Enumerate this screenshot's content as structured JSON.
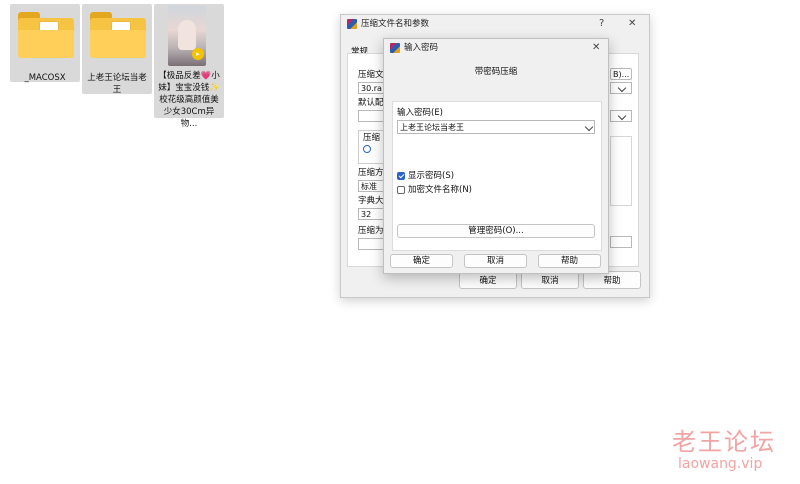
{
  "desktop": {
    "items": [
      {
        "label": "_MACOSX",
        "icon": "folder-icon"
      },
      {
        "label": "上老王论坛当老王",
        "icon": "folder-icon"
      },
      {
        "label": "【极品反差💗小妹】宝宝没钱✨校花级高颜值美少女30Cm异物...",
        "icon": "image-thumbnail"
      }
    ]
  },
  "archive_dialog": {
    "title": "压缩文件名和参数",
    "help_glyph": "?",
    "close_glyph": "✕",
    "tab_general": "常规",
    "labels": {
      "archive_name": "压缩文",
      "default_profile": "默认配",
      "archive_format": "压缩",
      "method": "压缩方",
      "dictionary": "字典大",
      "split": "压缩为"
    },
    "values": {
      "archive_name": "30.ra",
      "browse": "B)...",
      "method": "标准",
      "dictionary": "32"
    },
    "buttons": {
      "ok": "确定",
      "cancel": "取消",
      "help": "帮助"
    }
  },
  "password_dialog": {
    "title": "输入密码",
    "close_glyph": "✕",
    "heading": "带密码压缩",
    "input_label": "输入密码(E)",
    "password_value": "上老王论坛当老王",
    "show_password": {
      "label": "显示密码(S)",
      "checked": true
    },
    "encrypt_names": {
      "label": "加密文件名称(N)",
      "checked": false
    },
    "manage_button": "管理密码(O)...",
    "buttons": {
      "ok": "确定",
      "cancel": "取消",
      "help": "帮助"
    }
  },
  "watermark": {
    "cn": "老王论坛",
    "url": "laowang.vip"
  },
  "colors": {
    "accent": "#2764c5",
    "folder": "#f7c343",
    "watermark": "#f2a3a3"
  }
}
